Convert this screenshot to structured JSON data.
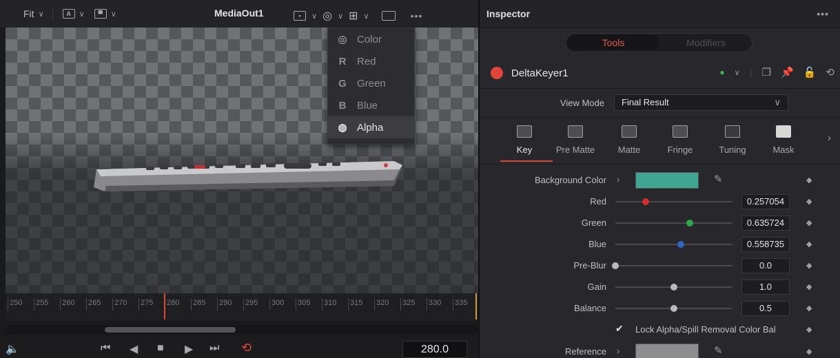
{
  "viewer": {
    "toolbar": {
      "fit_label": "Fit",
      "title": "MediaOut1",
      "more": "•••"
    },
    "channel_menu": {
      "items": [
        {
          "icon": "color-channels-icon",
          "glyph": "◎",
          "label": "Color"
        },
        {
          "icon": "red-channel-icon",
          "glyph": "R",
          "label": "Red"
        },
        {
          "icon": "green-channel-icon",
          "glyph": "G",
          "label": "Green"
        },
        {
          "icon": "blue-channel-icon",
          "glyph": "B",
          "label": "Blue"
        },
        {
          "icon": "alpha-channel-icon",
          "glyph": "◍",
          "label": "Alpha",
          "selected": true
        }
      ]
    },
    "ruler_ticks": [
      "250",
      "255",
      "260",
      "265",
      "270",
      "275",
      "280",
      "285",
      "290",
      "295",
      "300",
      "305",
      "310",
      "315",
      "320",
      "325",
      "330",
      "335"
    ],
    "current_frame": "280.0"
  },
  "inspector": {
    "title": "Inspector",
    "more": "•••",
    "tabs": {
      "tools": "Tools",
      "modifiers": "Modifiers"
    },
    "node_name": "DeltaKeyer1",
    "view_mode": {
      "label": "View Mode",
      "value": "Final Result"
    },
    "section_tabs": [
      "Key",
      "Pre Matte",
      "Matte",
      "Fringe",
      "Tuning",
      "Mask"
    ],
    "active_tab": "Key",
    "background_color": {
      "label": "Background Color",
      "hex": "#41a691"
    },
    "params": [
      {
        "label": "Red",
        "value": "0.257054",
        "fraction": 0.257054,
        "knob_color": "#d03030"
      },
      {
        "label": "Green",
        "value": "0.635724",
        "fraction": 0.635724,
        "knob_color": "#2fa84a"
      },
      {
        "label": "Blue",
        "value": "0.558735",
        "fraction": 0.558735,
        "knob_color": "#2f64c8"
      },
      {
        "label": "Pre-Blur",
        "value": "0.0",
        "fraction": 0.0,
        "knob_color": "#b8b8b8"
      },
      {
        "label": "Gain",
        "value": "1.0",
        "fraction": 0.5,
        "knob_color": "#b8b8b8"
      },
      {
        "label": "Balance",
        "value": "0.5",
        "fraction": 0.5,
        "knob_color": "#b8b8b8"
      }
    ],
    "lock_label": "Lock Alpha/Spill Removal Color Bal",
    "reference_label": "Reference"
  }
}
